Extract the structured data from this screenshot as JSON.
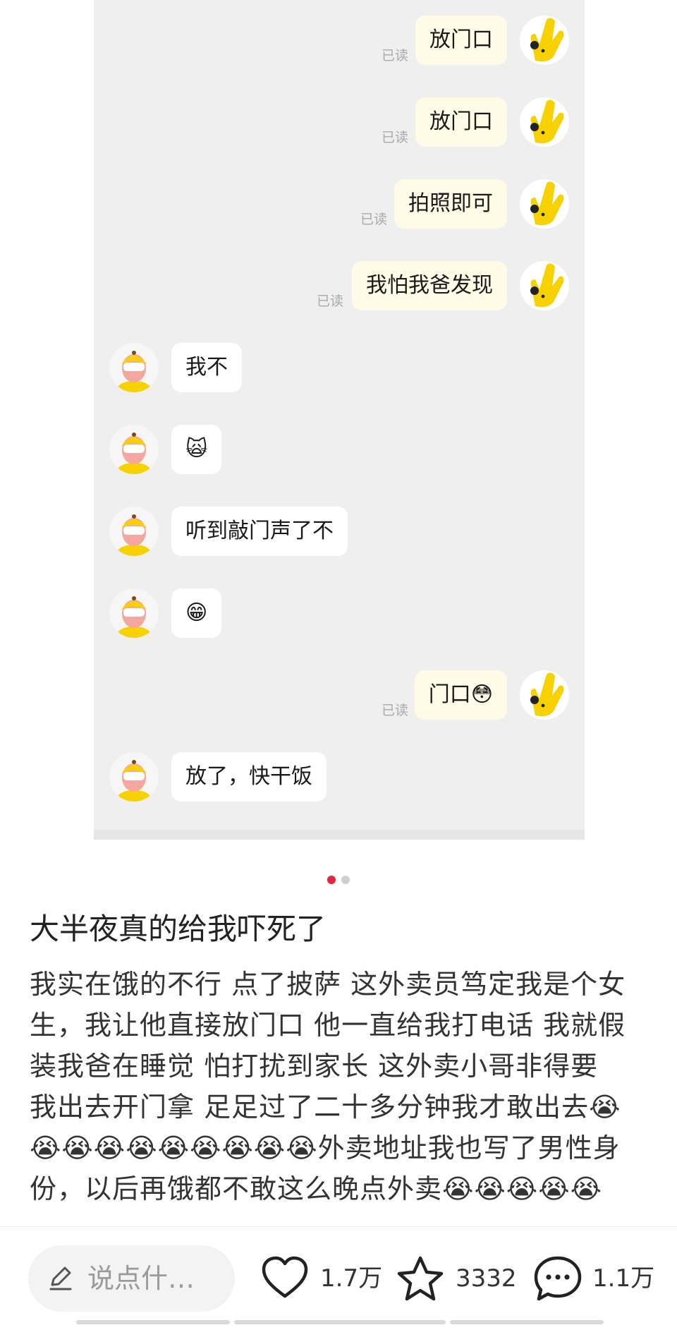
{
  "chat": {
    "read_label": "已读",
    "messages": [
      {
        "side": "right",
        "text": "放门口"
      },
      {
        "side": "right",
        "text": "放门口"
      },
      {
        "side": "right",
        "text": "拍照即可"
      },
      {
        "side": "right",
        "text": "我怕我爸发现"
      },
      {
        "side": "left",
        "text": "我不"
      },
      {
        "side": "left",
        "text": "🙀"
      },
      {
        "side": "left",
        "text": "听到敲门声了不"
      },
      {
        "side": "left",
        "text": "😁"
      },
      {
        "side": "right",
        "text": "门口😳"
      },
      {
        "side": "left",
        "text": "放了，快干饭"
      }
    ]
  },
  "pagination": {
    "current": 1,
    "total": 2
  },
  "post": {
    "title": "大半夜真的给我吓死了",
    "lines": [
      "我实在饿的不行 点了披萨 这外卖员笃定我是个女",
      "生，我让他直接放门口 他一直给我打电话 我就假",
      "装我爸在睡觉 怕打扰到家长 这外卖小哥非得要",
      "我出去开门拿 足足过了二十多分钟我才敢出去😭",
      "😭😭😭😭😭😭😭😭😭外卖地址我也写了男性身",
      "份，以后再饿都不敢这么晚点外卖😭😭😭😭😭"
    ]
  },
  "action_bar": {
    "comment_placeholder": "说点什…",
    "likes": "1.7万",
    "collects": "3332",
    "comments": "1.1万"
  },
  "colors": {
    "accent": "#e5263d",
    "bubble_self": "#fffbe6",
    "bubble_other": "#ffffff",
    "chat_bg": "#efefef"
  },
  "icons": {
    "edit": "pencil-icon",
    "like": "heart-icon",
    "collect": "star-icon",
    "comment": "chat-bubble-icon"
  }
}
